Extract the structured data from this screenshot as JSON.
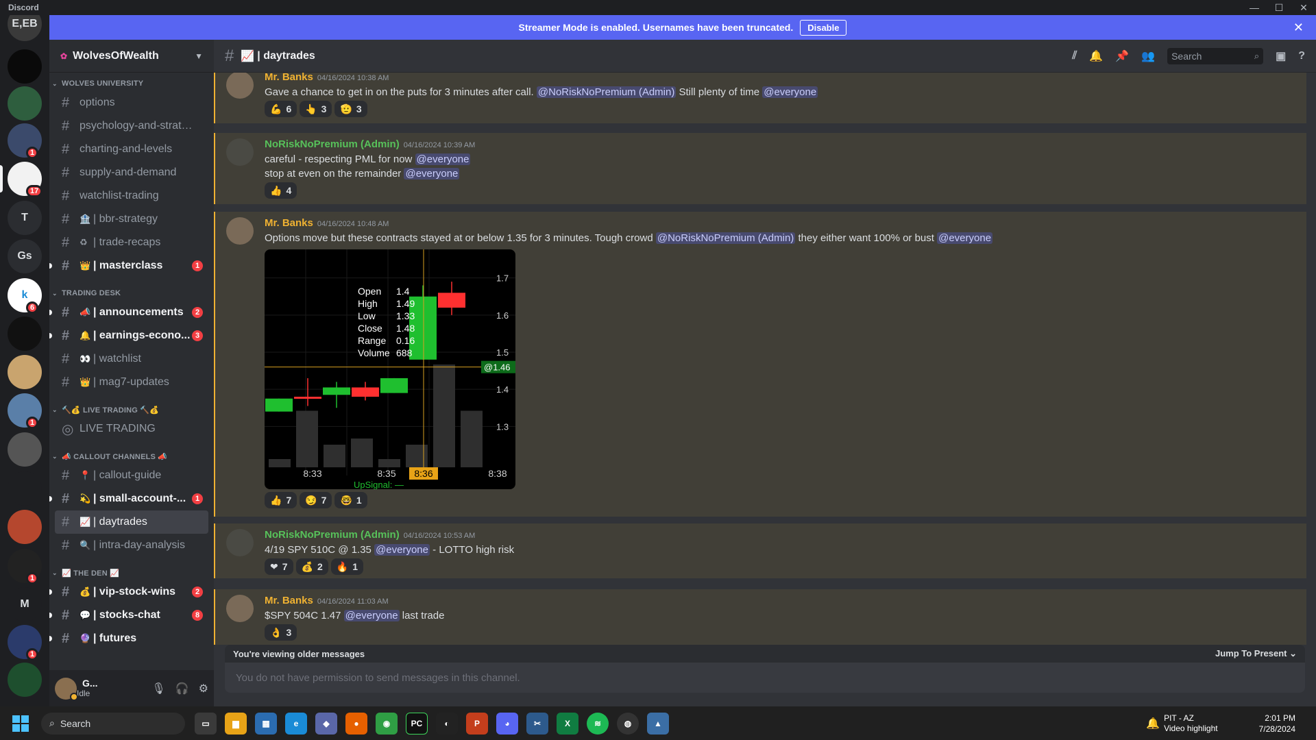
{
  "window": {
    "app_name": "Discord"
  },
  "banner": {
    "text": "Streamer Mode is enabled. Usernames have been truncated.",
    "button": "Disable"
  },
  "guilds": [
    {
      "label": "E,EB",
      "badge": ""
    },
    {
      "label": "",
      "badge": ""
    },
    {
      "label": "",
      "badge": ""
    },
    {
      "label": "",
      "badge": "1"
    },
    {
      "label": "",
      "badge": "17"
    },
    {
      "label": "T",
      "badge": ""
    },
    {
      "label": "Gs",
      "badge": ""
    },
    {
      "label": "k",
      "badge": "6"
    },
    {
      "label": "",
      "badge": ""
    },
    {
      "label": "",
      "badge": ""
    },
    {
      "label": "",
      "badge": "1"
    },
    {
      "label": "",
      "badge": ""
    },
    {
      "label": "",
      "badge": ""
    },
    {
      "label": "",
      "badge": ""
    },
    {
      "label": "",
      "badge": "1"
    },
    {
      "label": "M",
      "badge": ""
    },
    {
      "label": "",
      "badge": "1"
    },
    {
      "label": "",
      "badge": ""
    }
  ],
  "server": {
    "name": "WolvesOfWealth"
  },
  "sidebar": {
    "cat1": "WOLVES UNIVERSITY",
    "ch": [
      {
        "emoji": "",
        "name": "options"
      },
      {
        "emoji": "",
        "name": "psychology-and-strategi..."
      },
      {
        "emoji": "",
        "name": "charting-and-levels"
      },
      {
        "emoji": "",
        "name": "supply-and-demand"
      },
      {
        "emoji": "",
        "name": "watchlist-trading"
      },
      {
        "emoji": "🏦",
        "name": "| bbr-strategy"
      },
      {
        "emoji": "♻",
        "name": "| trade-recaps"
      },
      {
        "emoji": "👑",
        "name": "| masterclass",
        "badge": "1"
      }
    ],
    "cat2": "TRADING DESK",
    "ch2": [
      {
        "emoji": "📣",
        "name": "| announcements",
        "badge": "2"
      },
      {
        "emoji": "🔔",
        "name": "| earnings-econo...",
        "badge": "3"
      },
      {
        "emoji": "👀",
        "name": "| watchlist"
      },
      {
        "emoji": "👑",
        "name": "| mag7-updates"
      }
    ],
    "cat3": "🔨💰 LIVE TRADING 🔨💰",
    "voice": "LIVE TRADING",
    "cat4": "📣 CALLOUT CHANNELS 📣",
    "ch4": [
      {
        "emoji": "📍",
        "name": "| callout-guide"
      },
      {
        "emoji": "💫",
        "name": "| small-account-...",
        "badge": "1"
      },
      {
        "emoji": "📈",
        "name": "| daytrades"
      },
      {
        "emoji": "🔍",
        "name": "| intra-day-analysis"
      }
    ],
    "cat5": "📈 THE DEN 📈",
    "ch5": [
      {
        "emoji": "💰",
        "name": "| vip-stock-wins",
        "badge": "2"
      },
      {
        "emoji": "💬",
        "name": "| stocks-chat",
        "badge": "8"
      },
      {
        "emoji": "🔮",
        "name": "| futures"
      }
    ]
  },
  "user": {
    "name": "G...",
    "status": "Idle"
  },
  "channel_header": {
    "emoji": "📈",
    "name": "| daytrades",
    "search_placeholder": "Search"
  },
  "messages": [
    {
      "author": "Mr. Banks",
      "time": "04/16/2024 10:38 AM",
      "t1": "Gave a chance to get in on the puts for 3 minutes after call. ",
      "m1": "@NoRiskNoPremium (Admin)",
      "t2": " Still plenty of time ",
      "m2": "@everyone",
      "reactions": [
        {
          "e": "💪",
          "n": "6"
        },
        {
          "e": "👆",
          "n": "3"
        },
        {
          "e": "🫡",
          "n": "3"
        }
      ]
    },
    {
      "author": "NoRiskNoPremium (Admin)",
      "time": "04/16/2024 10:39 AM",
      "l1": "careful - respecting PML for now ",
      "l1m": "@everyone",
      "l2": "stop at even on the remainder ",
      "l2m": "@everyone",
      "reactions": [
        {
          "e": "👍",
          "n": "4"
        }
      ]
    },
    {
      "author": "Mr. Banks",
      "time": "04/16/2024 10:48 AM",
      "t1": "Options move but these contracts stayed at or below 1.35 for 3 minutes. Tough crowd ",
      "m1": "@NoRiskNoPremium (Admin)",
      "t2": " they either want 100% or bust ",
      "m2": "@everyone",
      "reactions": [
        {
          "e": "👍",
          "n": "7"
        },
        {
          "e": "😏",
          "n": "7"
        },
        {
          "e": "🤓",
          "n": "1"
        }
      ]
    },
    {
      "author": "NoRiskNoPremium (Admin)",
      "time": "04/16/2024 10:53 AM",
      "t1": "4/19 SPY 510C @ 1.35 ",
      "m1": "@everyone",
      "t2": "  - LOTTO  high risk",
      "reactions": [
        {
          "e": "❤",
          "n": "7"
        },
        {
          "e": "💰",
          "n": "2"
        },
        {
          "e": "🔥",
          "n": "1"
        }
      ]
    },
    {
      "author": "Mr. Banks",
      "time": "04/16/2024 11:03 AM",
      "t1": "$SPY 504C 1.47 ",
      "m1": "@everyone",
      "t2": "  last trade",
      "reactions": [
        {
          "e": "👌",
          "n": "3"
        }
      ]
    }
  ],
  "chart_data": {
    "type": "candlestick",
    "x_ticks": [
      "8:33",
      "8:35",
      "8:36",
      "8:38"
    ],
    "y_ticks": [
      "1.7",
      "1.6",
      "1.5",
      "1.4",
      "1.3"
    ],
    "ohlc_info": [
      [
        "Open",
        "1.4"
      ],
      [
        "High",
        "1.49"
      ],
      [
        "Low",
        "1.33"
      ],
      [
        "Close",
        "1.48"
      ],
      [
        "Range",
        "0.16"
      ],
      [
        "Volume",
        "688"
      ]
    ],
    "price_tag": "@1.46",
    "footer": "UpSignal: —",
    "candles": [
      {
        "o": 1.34,
        "c": 1.375,
        "h": 1.375,
        "l": 1.34,
        "up": true
      },
      {
        "o": 1.38,
        "c": 1.375,
        "h": 1.43,
        "l": 1.355,
        "up": false
      },
      {
        "o": 1.385,
        "c": 1.405,
        "h": 1.42,
        "l": 1.35,
        "up": true
      },
      {
        "o": 1.405,
        "c": 1.38,
        "h": 1.42,
        "l": 1.37,
        "up": false
      },
      {
        "o": 1.39,
        "c": 1.43,
        "h": 1.43,
        "l": 1.39,
        "up": true
      },
      {
        "o": 1.48,
        "c": 1.65,
        "h": 1.68,
        "l": 1.48,
        "up": true
      },
      {
        "o": 1.66,
        "c": 1.62,
        "h": 1.69,
        "l": 1.6,
        "up": false
      }
    ],
    "volume_rel": [
      0.08,
      0.55,
      0.22,
      0.28,
      0.08,
      0.22,
      1.0,
      0.55
    ]
  },
  "composer": {
    "older": "You're viewing older messages",
    "jump": "Jump To Present",
    "placeholder": "You do not have permission to send messages in this channel."
  },
  "taskbar": {
    "search": "Search",
    "notif_title": "PIT - AZ",
    "notif_sub": "Video highlight",
    "time": "2:01 PM",
    "date": "7/28/2024"
  }
}
